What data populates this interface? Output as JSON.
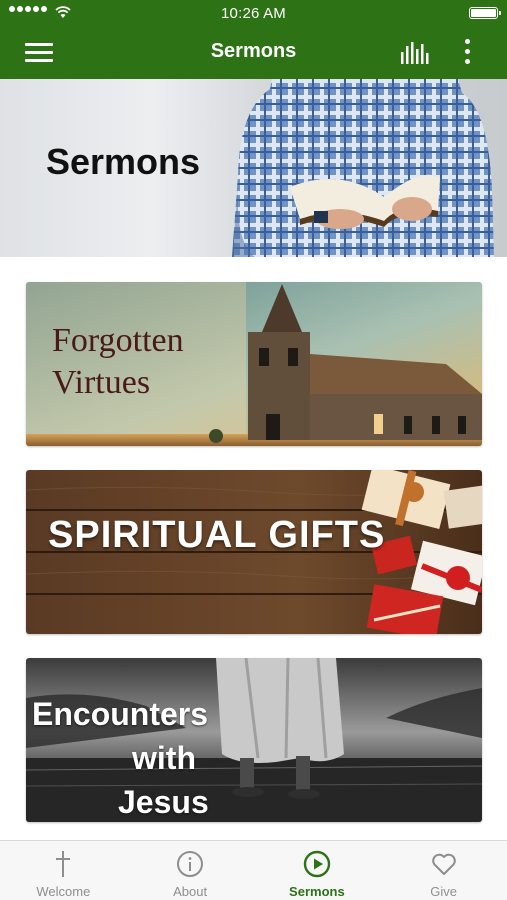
{
  "status_bar": {
    "time": "10:26 AM"
  },
  "app_bar": {
    "title": "Sermons",
    "menu_icon": "hamburger-menu-icon",
    "audio_icon": "equalizer-icon",
    "more_icon": "more-vertical-icon"
  },
  "hero": {
    "title": "Sermons"
  },
  "sermons": [
    {
      "title_line1": "Forgotten",
      "title_line2": "Virtues"
    },
    {
      "title": "SPIRITUAL GIFTS"
    },
    {
      "title_line1": "Encounters",
      "title_line2": "with",
      "title_line3": "Jesus"
    }
  ],
  "tabs": [
    {
      "label": "Welcome",
      "icon": "cross-icon"
    },
    {
      "label": "About",
      "icon": "info-icon"
    },
    {
      "label": "Sermons",
      "icon": "play-circle-icon",
      "active": true
    },
    {
      "label": "Give",
      "icon": "heart-icon"
    }
  ],
  "colors": {
    "brand": "#2e7216",
    "tab_inactive": "#8e8e8e"
  }
}
